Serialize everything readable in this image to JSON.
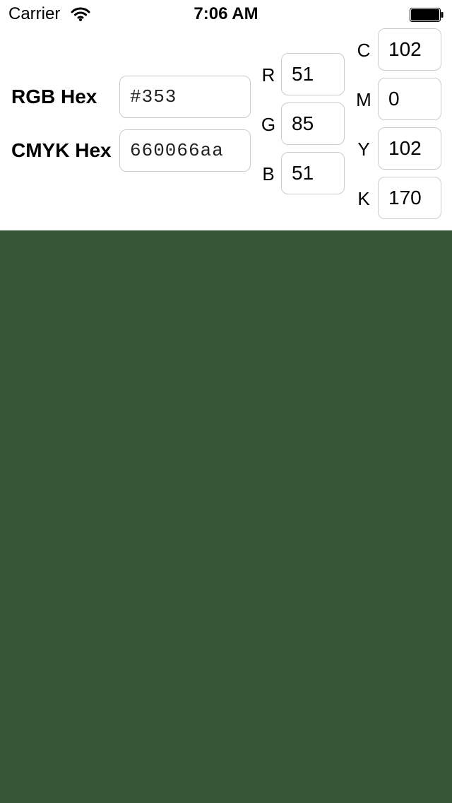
{
  "status_bar": {
    "carrier": "Carrier",
    "time": "7:06 AM",
    "wifi_icon": "wifi-icon",
    "battery_icon": "battery-icon"
  },
  "rgb_hex": {
    "label": "RGB Hex",
    "value": "#353"
  },
  "cmyk_hex": {
    "label": "CMYK Hex",
    "value": "660066aa"
  },
  "rgb": {
    "r_label": "R",
    "r_value": "51",
    "g_label": "G",
    "g_value": "85",
    "b_label": "B",
    "b_value": "51"
  },
  "cmyk": {
    "c_label": "C",
    "c_value": "102",
    "m_label": "M",
    "m_value": "0",
    "y_label": "Y",
    "y_value": "102",
    "k_label": "K",
    "k_value": "170"
  },
  "colors": {
    "swatch": "#355535"
  }
}
